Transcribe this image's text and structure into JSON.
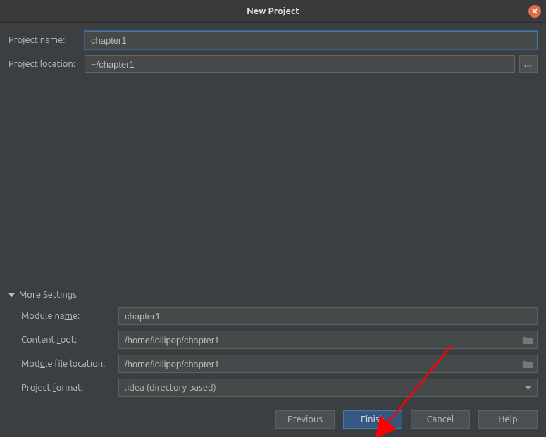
{
  "window": {
    "title": "New Project"
  },
  "fields": {
    "project_name_label": "Project name:",
    "project_name_value": "chapter1",
    "project_location_label": "Project location:",
    "project_location_value": "~/chapter1",
    "browse_ellipsis": "..."
  },
  "more": {
    "header": "More Settings",
    "module_name_label": "Module name:",
    "module_name_value": "chapter1",
    "content_root_label": "Content root:",
    "content_root_value": "/home/lollipop/chapter1",
    "module_file_label": "Module file location:",
    "module_file_value": "/home/lollipop/chapter1",
    "project_format_label": "Project format:",
    "project_format_value": ".idea (directory based)"
  },
  "buttons": {
    "previous": "Previous",
    "finish": "Finish",
    "cancel": "Cancel",
    "help": "Help"
  }
}
